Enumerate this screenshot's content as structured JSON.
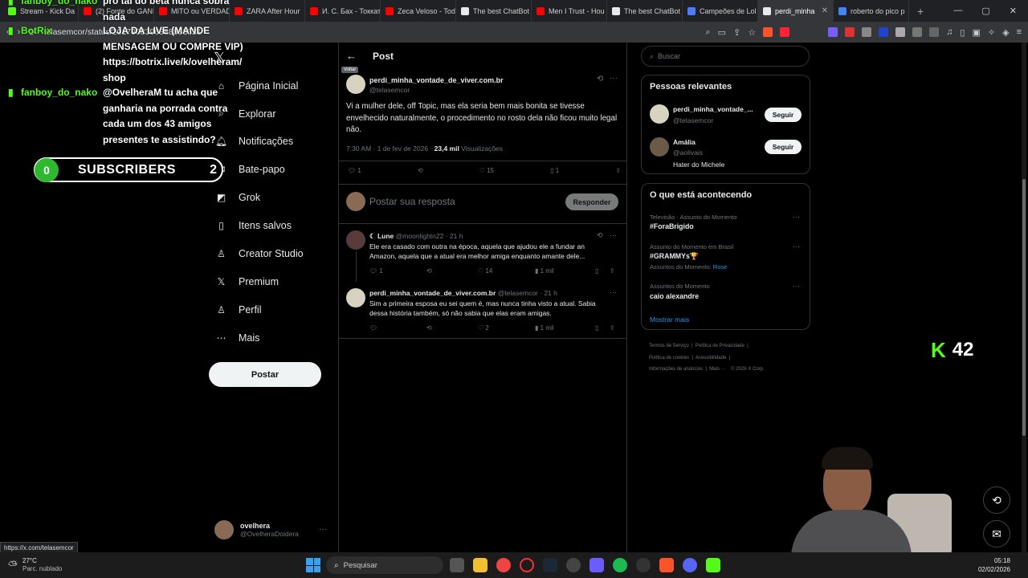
{
  "tabs": [
    {
      "label": "Stream - Kick Da",
      "color": "#53fc18"
    },
    {
      "label": "(2) Fonte do GANH",
      "color": "#ff0000"
    },
    {
      "label": "MITO ou VERDADE",
      "color": "#ff0000"
    },
    {
      "label": "ZARA After Hour",
      "color": "#ff0000"
    },
    {
      "label": "И. С. Бах - Токкат",
      "color": "#ff0000"
    },
    {
      "label": "Zeca Veloso - Tod",
      "color": "#ff0000"
    },
    {
      "label": "The best ChatBot",
      "color": "#e7e9ea"
    },
    {
      "label": "Men I Trust - Hou",
      "color": "#ff0000"
    },
    {
      "label": "The best ChatBot",
      "color": "#e7e9ea"
    },
    {
      "label": "Campeões de Lol",
      "color": "#4a7cff"
    },
    {
      "label": "perdi_minha",
      "color": "#e7e9ea",
      "active": true
    },
    {
      "label": "roberto do pico p",
      "color": "#4285f4"
    }
  ],
  "browser": {
    "url": "telasemcor/status/2017908396888883321",
    "new_tab": "+",
    "win_min": "—",
    "win_max": "▢",
    "win_close": "✕"
  },
  "sidebar": {
    "items": [
      {
        "label": "Página Inicial",
        "icon": "⌂"
      },
      {
        "label": "Explorar",
        "icon": "⌕"
      },
      {
        "label": "Notificações",
        "icon": "🔔︎"
      },
      {
        "label": "Bate-papo",
        "icon": "✉"
      },
      {
        "label": "Grok",
        "icon": "◩"
      },
      {
        "label": "Itens salvos",
        "icon": "▯"
      },
      {
        "label": "Creator Studio",
        "icon": "♙"
      },
      {
        "label": "Premium",
        "icon": "𝕏"
      },
      {
        "label": "Perfil",
        "icon": "♙"
      },
      {
        "label": "Mais",
        "icon": "⋯"
      }
    ],
    "post_button": "Postar",
    "account_name": "ovelhera",
    "account_handle": "@OvelheraDoidera"
  },
  "main": {
    "header_title": "Post",
    "back_tooltip": "Voltar",
    "post": {
      "author": "perdi_minha_vontade_de_viver.com.br",
      "handle": "@telasemcor",
      "text": "Vi a mulher dele, off Topic, mas ela seria bem mais bonita se tivesse envelhecido naturalmente, o procedimento no rosto dela não ficou muito legal não.",
      "time": "7:30 AM · 1 de fev de 2026 ·",
      "views": "23,4 mil",
      "views_label": "Visualizações",
      "replies": "1",
      "likes": "15",
      "bookmarks": "1"
    },
    "reply_placeholder": "Postar sua resposta",
    "reply_button": "Responder",
    "replies": [
      {
        "author": "☾ Lune",
        "handle": "@moonlightn22 · 21 h",
        "text": "Ele era casado com outra na época, aquela que ajudou ele a fundar an Amazon, aquela que a atual era melhor amiga enquanto amante dele...",
        "replies": "1",
        "retweets": "",
        "likes": "14",
        "views": "1 mil"
      },
      {
        "author": "perdi_minha_vontade_de_viver.com.br",
        "handle": "@telasemcor · 21 h",
        "text": "Sim a primeira esposa eu sei quem é, mas nunca tinha visto a atual. Sabia dessa história também, só não sabia que elas eram amigas.",
        "replies": "",
        "retweets": "",
        "likes": "2",
        "views": "1 mil"
      }
    ]
  },
  "right": {
    "search_placeholder": "Buscar",
    "relevant_title": "Pessoas relevantes",
    "people": [
      {
        "name": "perdi_minha_vontade_...",
        "handle": "@telasemcor",
        "bio": "",
        "button": "Seguir"
      },
      {
        "name": "Amália",
        "handle": "@aolivais",
        "bio": "Hater do Michele",
        "button": "Seguir"
      }
    ],
    "trending_title": "O que está acontecendo",
    "trends": [
      {
        "context": "Televisão · Assunto do Momento",
        "topic": "#ForaBrigido",
        "extra": ""
      },
      {
        "context": "Assunto do Momento em Brasil",
        "topic": "#GRAMMYs🏆",
        "extra": "Assuntos do Momento: ",
        "extra_link": "Rose"
      },
      {
        "context": "Assuntos do Momento",
        "topic": "caio alexandre",
        "extra": ""
      }
    ],
    "show_more": "Mostrar mais",
    "footer": [
      "Termos de Serviço",
      "Política de Privacidade",
      "Política de cookies",
      "Acessibilidade",
      "Informações de anúncios",
      "Mais ···",
      "© 2026 X Corp."
    ]
  },
  "overlay": {
    "chat_line0_user": "fanboy_do_nako",
    "chat_line0_text": "pro tal do beta nunca sobra nada",
    "chat_bot_user": "BotRix",
    "chat_bot_text": "LOJA DA LIVE (MANDE MENSAGEM OU COMPRE VIP) https://botrix.live/k/ovelheram/ shop",
    "chat_user2": "fanboy_do_nako",
    "chat_text2": "@OvelheraM tu acha que ganharia na porrada contra cada um dos 43 amigos presentes te assistindo?",
    "sub_count": "0",
    "sub_label": "SUBSCRIBERS",
    "sub_right": "2",
    "viewers": "42"
  },
  "status_url": "https://x.com/telasemcor",
  "taskbar": {
    "weather_temp": "27°C",
    "weather_desc": "Parc. nublado",
    "search": "Pesquisar",
    "time": "05:18",
    "date": "02/02/2026"
  }
}
